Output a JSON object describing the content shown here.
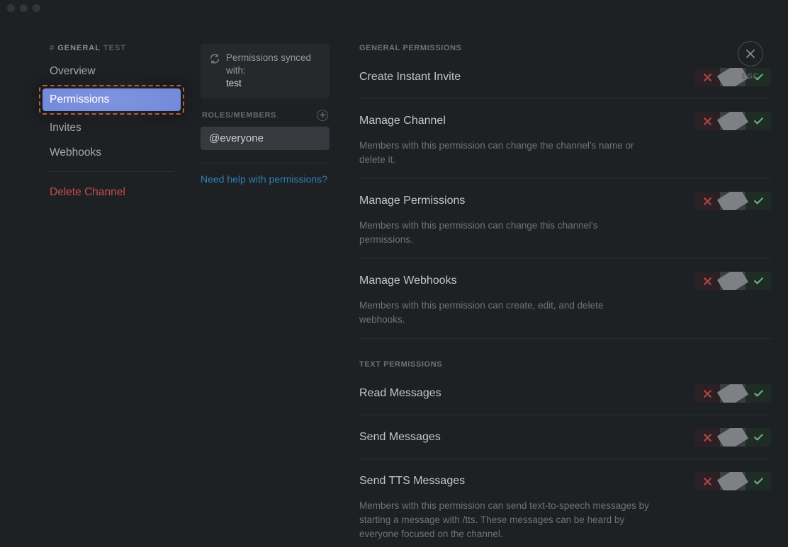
{
  "breadcrumb": {
    "prefix": "#",
    "channel": "GENERAL",
    "suffix": "TEST"
  },
  "sidebar": {
    "overview": "Overview",
    "permissions": "Permissions",
    "invites": "Invites",
    "webhooks": "Webhooks",
    "delete": "Delete Channel"
  },
  "sync": {
    "label": "Permissions synced with:",
    "target": "test"
  },
  "roles_header": "ROLES/MEMBERS",
  "roles": {
    "item0": "@everyone"
  },
  "help_link": "Need help with permissions?",
  "sections": {
    "general": "GENERAL PERMISSIONS",
    "text": "TEXT PERMISSIONS"
  },
  "perms": {
    "create_invite": {
      "name": "Create Instant Invite"
    },
    "manage_channel": {
      "name": "Manage Channel",
      "desc": "Members with this permission can change the channel's name or delete it."
    },
    "manage_permissions": {
      "name": "Manage Permissions",
      "desc": "Members with this permission can change this channel's permissions."
    },
    "manage_webhooks": {
      "name": "Manage Webhooks",
      "desc": "Members with this permission can create, edit, and delete webhooks."
    },
    "read_messages": {
      "name": "Read Messages"
    },
    "send_messages": {
      "name": "Send Messages"
    },
    "send_tts": {
      "name": "Send TTS Messages",
      "desc": "Members with this permission can send text-to-speech messages by starting a message with /tts. These messages can be heard by everyone focused on the channel."
    }
  },
  "close": {
    "esc": "ESC"
  },
  "colors": {
    "accent": "#7289da",
    "deny": "#b04747",
    "allow": "#69b078",
    "highlight": "#e47853"
  }
}
